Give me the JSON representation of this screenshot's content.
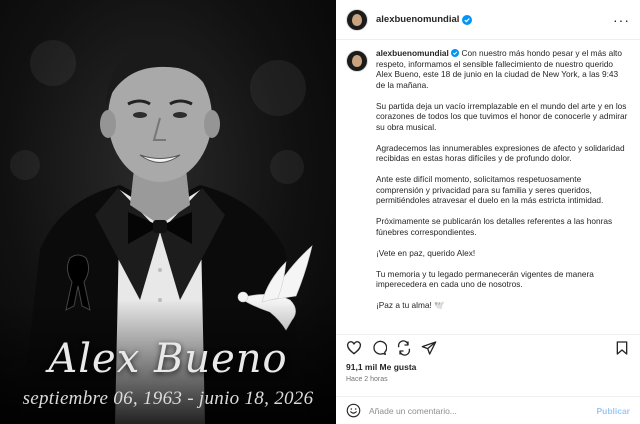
{
  "media": {
    "memorial_name": "Alex Bueno",
    "memorial_dates": "septiembre 06, 1963 - junio 18, 2026"
  },
  "header": {
    "username": "alexbuenomundial",
    "verified": true,
    "more_label": "···"
  },
  "caption": {
    "username": "alexbuenomundial",
    "paragraphs": [
      "Con nuestro más hondo pesar y el más alto respeto, informamos el sensible fallecimiento de nuestro querido Alex Bueno, este 18 de junio en la ciudad de New York, a las 9:43 de la mañana.",
      "Su partida deja un vacío irremplazable en el mundo del arte y en los corazones de todos los que tuvimos el honor de conocerle y admirar su obra musical.",
      "Agradecemos las innumerables expresiones de afecto y solidaridad recibidas en estas horas difíciles y de profundo dolor.",
      "Ante este difícil momento, solicitamos respetuosamente comprensión y privacidad para su familia y seres queridos, permitiéndoles atravesar el duelo en la más estricta intimidad.",
      "Próximamente se publicarán los detalles referentes a las honras fúnebres correspondientes.",
      "¡Vete en paz, querido Alex!",
      "Tu memoria y tu legado permanecerán vigentes de manera imperecedera en cada uno de nosotros.",
      "¡Paz a tu alma! 🕊️"
    ]
  },
  "actions": {
    "icons": [
      "heart-icon",
      "comment-icon",
      "share-icon",
      "send-icon",
      "bookmark-icon"
    ]
  },
  "likes": "91,1 mil Me gusta",
  "time": "Hace 2 horas",
  "comment": {
    "placeholder": "Añade un comentario...",
    "publish_label": "Publicar"
  },
  "colors": {
    "verified_blue": "#0095f6",
    "publish_blue": "#9cc9f6",
    "muted_text": "#737373"
  }
}
